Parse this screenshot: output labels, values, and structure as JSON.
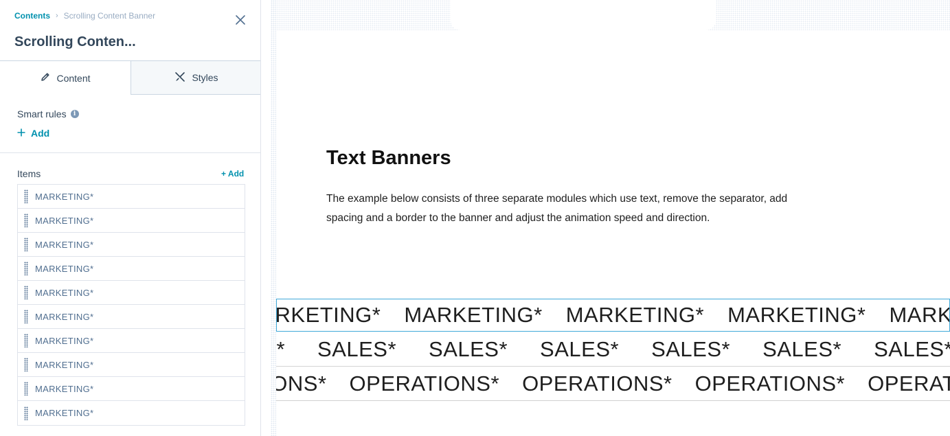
{
  "sidebar": {
    "breadcrumb": {
      "root": "Contents",
      "separator": "›",
      "current": "Scrolling Content Banner"
    },
    "title": "Scrolling Conten...",
    "tabs": [
      {
        "label": "Content",
        "icon": "pencil-icon",
        "active": true
      },
      {
        "label": "Styles",
        "icon": "paintbrush-icon",
        "active": false
      }
    ],
    "smart_rules": {
      "label": "Smart rules",
      "add_label": "Add",
      "info_icon": "i"
    },
    "items": {
      "label": "Items",
      "add_label": "+ Add",
      "list": [
        "MARKETING*",
        "MARKETING*",
        "MARKETING*",
        "MARKETING*",
        "MARKETING*",
        "MARKETING*",
        "MARKETING*",
        "MARKETING*",
        "MARKETING*",
        "MARKETING*"
      ]
    }
  },
  "preview": {
    "title": "Text Banners",
    "description": "The example below consists of three separate modules which use text, remove the separator, add spacing and a border to the banner and adjust the animation speed and direction.",
    "banners": [
      {
        "words": [
          "MARKETING*",
          "MARKETING*",
          "MARKETING*",
          "MARKETING*",
          "MARKETING*"
        ]
      },
      {
        "words": [
          "SALES*",
          "SALES*",
          "SALES*",
          "SALES*",
          "SALES*",
          "SALES*",
          "SALES*"
        ]
      },
      {
        "words": [
          "OPERATIONS*",
          "OPERATIONS*",
          "OPERATIONS*",
          "OPERATIONS*",
          "OPERATIONS*"
        ]
      }
    ]
  },
  "colors": {
    "accent": "#0091ae",
    "text": "#33475b",
    "banner_border": "#3fa9d9"
  }
}
